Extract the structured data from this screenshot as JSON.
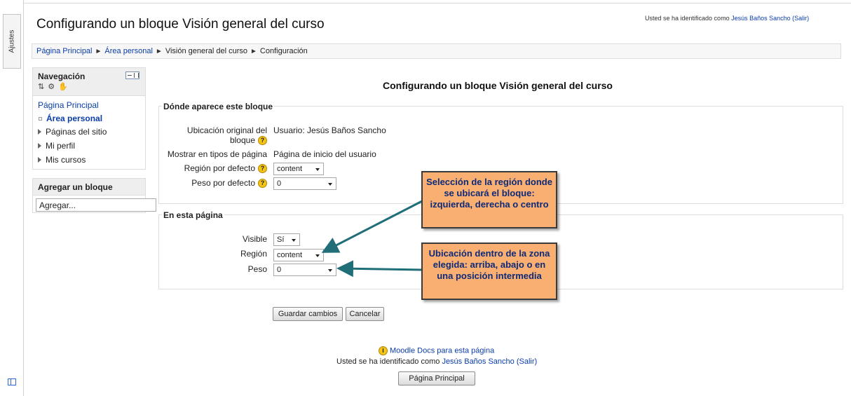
{
  "sidebar": {
    "tab_label": "Ajustes"
  },
  "header": {
    "title": "Configurando un bloque Visión general del curso",
    "login_prefix": "Usted se ha identificado como",
    "login_name": "Jesús Baños Sancho",
    "login_logout": "(Salir)"
  },
  "breadcrumb": {
    "items": [
      "Página Principal",
      "Área personal",
      "Visión general del curso",
      "Configuración"
    ],
    "separator": "►"
  },
  "nav": {
    "title": "Navegación",
    "icons_text": "⇅ ⚙ ✋",
    "items": [
      "Página Principal",
      "Área personal",
      "Páginas del sitio",
      "Mi perfil",
      "Mis cursos"
    ]
  },
  "add_block": {
    "title": "Agregar un bloque",
    "select_value": "Agregar..."
  },
  "main": {
    "heading": "Configurando un bloque Visión general del curso",
    "section1": {
      "legend": "Dónde aparece este bloque",
      "orig_label_1": "Ubicación original del",
      "orig_label_2": "bloque",
      "orig_value": "Usuario: Jesús Baños Sancho",
      "pagetypes_label": "Mostrar en tipos de página",
      "pagetypes_value": "Página de inicio del usuario",
      "region_label": "Región por defecto",
      "region_value": "content",
      "weight_label": "Peso por defecto",
      "weight_value": "0"
    },
    "section2": {
      "legend": "En esta página",
      "visible_label": "Visible",
      "visible_value": "Sí",
      "region_label": "Región",
      "region_value": "content",
      "weight_label": "Peso",
      "weight_value": "0"
    },
    "save_label": "Guardar cambios",
    "cancel_label": "Cancelar"
  },
  "callouts": {
    "region": "Selección de la región donde se ubicará el bloque: izquierda, derecha o centro",
    "position": "Ubicación dentro de la zona elegida: arriba, abajo o en una posición intermedia"
  },
  "footer": {
    "docs_link": "Moodle Docs para esta página",
    "login_prefix": "Usted se ha identificado como",
    "login_name": "Jesús Baños Sancho",
    "login_logout": "(Salir)",
    "home_button": "Página Principal"
  },
  "colors": {
    "link": "#0a3da8",
    "callout_fill": "#f9ae72",
    "callout_text": "#0c2a78",
    "arrow": "#1f6e78"
  }
}
